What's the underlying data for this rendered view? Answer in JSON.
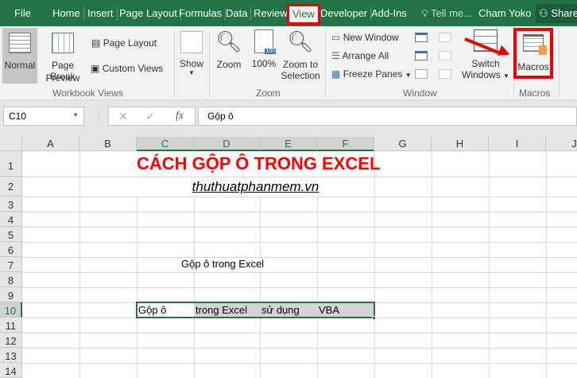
{
  "tabs": [
    "File",
    "Home",
    "Insert",
    "Page Layout",
    "Formulas",
    "Data",
    "Review",
    "View",
    "Developer",
    "Add-Ins"
  ],
  "tell_me": "Tell me...",
  "user": "Cham Yoko",
  "share": "Share",
  "ribbon": {
    "normal": "Normal",
    "page_break_1": "Page Break",
    "page_break_2": "Preview",
    "page_layout": "Page Layout",
    "custom_views": "Custom Views",
    "workbook_views": "Workbook Views",
    "show": "Show",
    "zoom": "Zoom",
    "zoom100": "100%",
    "zoom_sel_1": "Zoom to",
    "zoom_sel_2": "Selection",
    "zoom_group": "Zoom",
    "badge100": "100",
    "new_window": "New Window",
    "arrange_all": "Arrange All",
    "freeze_panes": "Freeze Panes",
    "switch_1": "Switch",
    "switch_2": "Windows",
    "window_group": "Window",
    "macros": "Macros",
    "macros_group": "Macros"
  },
  "name_box": "C10",
  "formula": "Gộp ô",
  "columns": [
    "A",
    "B",
    "C",
    "D",
    "E",
    "F",
    "G",
    "H",
    "I",
    "J"
  ],
  "rows": [
    "1",
    "2",
    "3",
    "4",
    "5",
    "6",
    "7",
    "8",
    "9",
    "10",
    "11",
    "12",
    "13",
    "14"
  ],
  "cells": {
    "title": "CÁCH GỘP Ô TRONG EXCEL",
    "site": "thuthuatphanmem.vn",
    "c7": "Gộp ô trong Excel",
    "c10": "Gộp ô",
    "d10": "trong Excel",
    "e10": "sử dụng",
    "f10": "VBA"
  },
  "colors": {
    "accent": "#217346",
    "highlight": "#e00000",
    "title": "#ff0000"
  }
}
